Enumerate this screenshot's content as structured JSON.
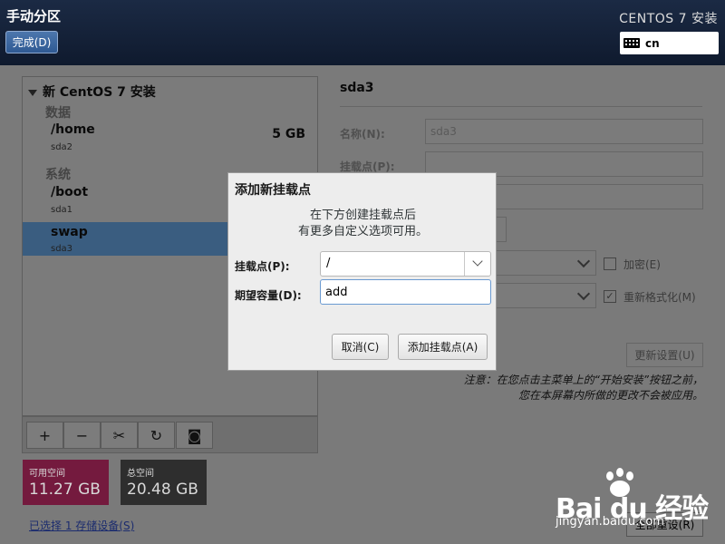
{
  "header": {
    "title": "手动分区",
    "done_label": "完成(D)",
    "product": "CENTOS 7 安装",
    "keyboard_layout": "cn"
  },
  "tree": {
    "root_label": "新 CentOS 7 安装",
    "groups": [
      {
        "label": "数据",
        "items": [
          {
            "mount": "/home",
            "device": "sda2",
            "size": "5 GB"
          }
        ]
      },
      {
        "label": "系统",
        "items": [
          {
            "mount": "/boot",
            "device": "sda1",
            "size": ""
          },
          {
            "mount": "swap",
            "device": "sda3",
            "size": "",
            "selected": true
          }
        ]
      }
    ]
  },
  "toolbar": {
    "add": "+",
    "remove": "−",
    "configure": "✂",
    "refresh": "↻",
    "disk": "◙"
  },
  "space": {
    "available_label": "可用空间",
    "available_value": "11.27 GB",
    "total_label": "总空间",
    "total_value": "20.48 GB",
    "available_color": "#741a3e"
  },
  "storage_link": "已选择 1 存储设备(S)",
  "details": {
    "selected_title": "sda3",
    "name_label": "名称(N):",
    "name_value": "sda3",
    "mount_label": "挂载点(P):",
    "encrypt_label": "加密(E)",
    "reformat_label": "重新格式化(M)",
    "update_label": "更新设置(U)",
    "note_line1": "注意：在您点击主菜单上的“开始安装”按钮之前，",
    "note_line2": "您在本屏幕内所做的更改不会被应用。",
    "reset_label": "全部重设(R)"
  },
  "dialog": {
    "title": "添加新挂载点",
    "desc_line1": "在下方创建挂载点后",
    "desc_line2": "有更多自定义选项可用。",
    "mount_label": "挂载点(P):",
    "mount_value": "/",
    "capacity_label": "期望容量(D):",
    "capacity_value": "add",
    "cancel_label": "取消(C)",
    "add_label": "添加挂载点(A)"
  },
  "watermark": {
    "logo_text": "Bai  du 经验",
    "url": "jingyan.baidu.com"
  }
}
